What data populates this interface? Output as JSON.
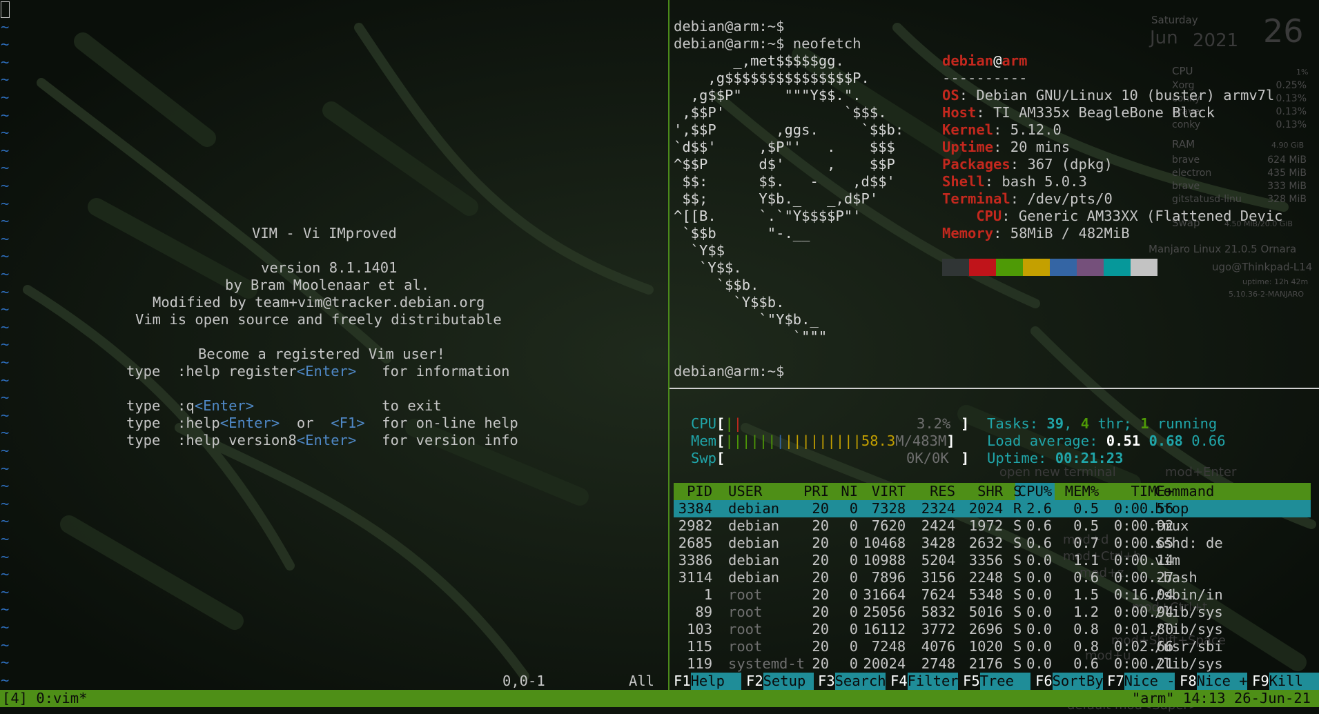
{
  "vim": {
    "splash": [
      "VIM - Vi IMproved",
      "version 8.1.1401",
      "by Bram Moolenaar et al.",
      "Modified by team+vim@tracker.debian.org",
      "Vim is open source and freely distributable",
      "Become a registered Vim user!"
    ],
    "help_lines": [
      {
        "a": "type  :help register",
        "k": "<Enter>",
        "b": "   for information"
      },
      {
        "a": "type  :q",
        "k": "<Enter>",
        "b": "               to exit"
      },
      {
        "a": "type  :help",
        "k": "<Enter>",
        "b": "  or  ",
        "k2": "<F1>",
        "c": "  for on-line help"
      },
      {
        "a": "type  :help version8",
        "k": "<Enter>",
        "b": "   for version info"
      }
    ],
    "tilde": "~",
    "position": "0,0-1",
    "scroll": "All"
  },
  "terminal": {
    "prompt": "debian@arm:~$",
    "command": "neofetch",
    "ascii": [
      "       _,met$$$$$gg.",
      "    ,g$$$$$$$$$$$$$$$P.",
      "  ,g$$P\"     \"\"\"Y$$.\".",
      " ,$$P'              `$$$.",
      "',$$P       ,ggs.     `$$b:",
      "`d$$'     ,$P\"'   .    $$$",
      "^$$P      d$'     ,    $$P",
      " $$:      $$.   -    ,d$$'",
      " $$;      Y$b._   _,d$P'",
      "^[[B.     `.`\"Y$$$$P\"'",
      " `$$b      \"-.__",
      "  `Y$$",
      "   `Y$$.",
      "     `$$b.",
      "       `Y$$b.",
      "          `\"Y$b._",
      "              `\"\"\""
    ],
    "user": "debian",
    "at": "@",
    "host": "arm",
    "separator": "----------",
    "info": [
      {
        "k": "OS",
        "v": "Debian GNU/Linux 10 (buster) armv7l"
      },
      {
        "k": "Host",
        "v": "TI AM335x BeagleBone Black"
      },
      {
        "k": "Kernel",
        "v": "5.12.0"
      },
      {
        "k": "Uptime",
        "v": "20 mins"
      },
      {
        "k": "Packages",
        "v": "367 (dpkg)"
      },
      {
        "k": "Shell",
        "v": "bash 5.0.3"
      },
      {
        "k": "Terminal",
        "v": "/dev/pts/0"
      },
      {
        "k": "CPU",
        "v": "Generic AM33XX (Flattened Devic"
      },
      {
        "k": "Memory",
        "v": "58MiB / 482MiB"
      }
    ],
    "swatches": [
      "#303535",
      "#c0141a",
      "#4e9a06",
      "#c4a000",
      "#3465a4",
      "#75507b",
      "#06989a",
      "#c3c3c3"
    ]
  },
  "htop": {
    "cpu_label": "CPU",
    "cpu_pct": "3.2%",
    "mem_label": "Mem",
    "mem_value": "58.3",
    "mem_total": "M/483M",
    "swp_label": "Swp",
    "swp_value": "0K/0K",
    "tasks_label": "Tasks:",
    "tasks": "39",
    "thr": "4",
    "thr_label": "thr;",
    "running": "1",
    "running_label": "running",
    "load_label": "Load average:",
    "load1": "0.51",
    "load5": "0.68",
    "load15": "0.66",
    "uptime_label": "Uptime:",
    "uptime": "00:21:23",
    "columns": [
      "PID",
      "USER",
      "PRI",
      "NI",
      "VIRT",
      "RES",
      "SHR",
      "S",
      "CPU%",
      "MEM%",
      "TIME+",
      "Command"
    ],
    "rows": [
      [
        "3384",
        "debian",
        "20",
        "0",
        "7328",
        "2324",
        "2024",
        "R",
        "2.6",
        "0.5",
        "0:00.56",
        "htop"
      ],
      [
        "2982",
        "debian",
        "20",
        "0",
        "7620",
        "2424",
        "1972",
        "S",
        "0.6",
        "0.5",
        "0:00.92",
        "tmux"
      ],
      [
        "2685",
        "debian",
        "20",
        "0",
        "10468",
        "3428",
        "2632",
        "S",
        "0.6",
        "0.7",
        "0:00.65",
        "sshd: de"
      ],
      [
        "3386",
        "debian",
        "20",
        "0",
        "10988",
        "5204",
        "3356",
        "S",
        "0.0",
        "1.1",
        "0:00.14",
        "vim"
      ],
      [
        "3114",
        "debian",
        "20",
        "0",
        "7896",
        "3156",
        "2248",
        "S",
        "0.0",
        "0.6",
        "0:00.27",
        "-bash"
      ],
      [
        "1",
        "root",
        "20",
        "0",
        "31664",
        "7624",
        "5348",
        "S",
        "0.0",
        "1.5",
        "0:16.04",
        "/sbin/in"
      ],
      [
        "89",
        "root",
        "20",
        "0",
        "25056",
        "5832",
        "5016",
        "S",
        "0.0",
        "1.2",
        "0:00.94",
        "/lib/sys"
      ],
      [
        "103",
        "root",
        "20",
        "0",
        "16112",
        "3772",
        "2696",
        "S",
        "0.0",
        "0.8",
        "0:01.80",
        "/lib/sys"
      ],
      [
        "115",
        "root",
        "20",
        "0",
        "7248",
        "4076",
        "1020",
        "S",
        "0.0",
        "0.8",
        "0:02.66",
        "/usr/sbi"
      ],
      [
        "119",
        "systemd-t",
        "20",
        "0",
        "20024",
        "2748",
        "2176",
        "S",
        "0.0",
        "0.6",
        "0:00.21",
        "/lib/sys"
      ]
    ],
    "fkeys": [
      {
        "k": "F1",
        "l": "Help  "
      },
      {
        "k": "F2",
        "l": "Setup "
      },
      {
        "k": "F3",
        "l": "Search"
      },
      {
        "k": "F4",
        "l": "Filter"
      },
      {
        "k": "F5",
        "l": "Tree  "
      },
      {
        "k": "F6",
        "l": "SortBy"
      },
      {
        "k": "F7",
        "l": "Nice -"
      },
      {
        "k": "F8",
        "l": "Nice +"
      },
      {
        "k": "F9",
        "l": "Kill  "
      }
    ]
  },
  "tmux": {
    "left": "[4] 0:vim*",
    "right": "\"arm\" 14:13 26-Jun-21"
  },
  "conky": {
    "day": "Saturday",
    "month": "Jun",
    "year": "2021",
    "date": "26",
    "cpu_label": "CPU",
    "cpu_total": "1%",
    "cpu_procs": [
      {
        "n": "Xorg",
        "v": "0.25%"
      },
      {
        "n": "conky",
        "v": "0.13%"
      },
      {
        "n": "brave",
        "v": "0.13%"
      },
      {
        "n": "conky",
        "v": "0.13%"
      }
    ],
    "ram_label": "RAM",
    "ram_total": "4.90 GiB",
    "ram_procs": [
      {
        "n": "brave",
        "v": "624 MiB"
      },
      {
        "n": "electron",
        "v": "435 MiB"
      },
      {
        "n": "brave",
        "v": "333 MiB"
      },
      {
        "n": "gitstatusd-linu",
        "v": "328 MiB"
      }
    ],
    "swap_label": "Swap",
    "swap_value": "4.50 MiB/20.0 GiB",
    "distro": "Manjaro Linux 21.0.5 Ornara",
    "user_host": "ugo@Thinkpad-L14",
    "uptime": "uptime: 12h 42m",
    "kernel": "5.10.36-2-MANJARO",
    "hints": [
      "open new terminal",
      "mod+Enter",
      "mod+d",
      "mod+Ctrl+b",
      "mod+z",
      "mod+Ctrl+t",
      "mod+Shift+Space",
      "mod+u",
      "default mod",
      "<Super>"
    ]
  }
}
